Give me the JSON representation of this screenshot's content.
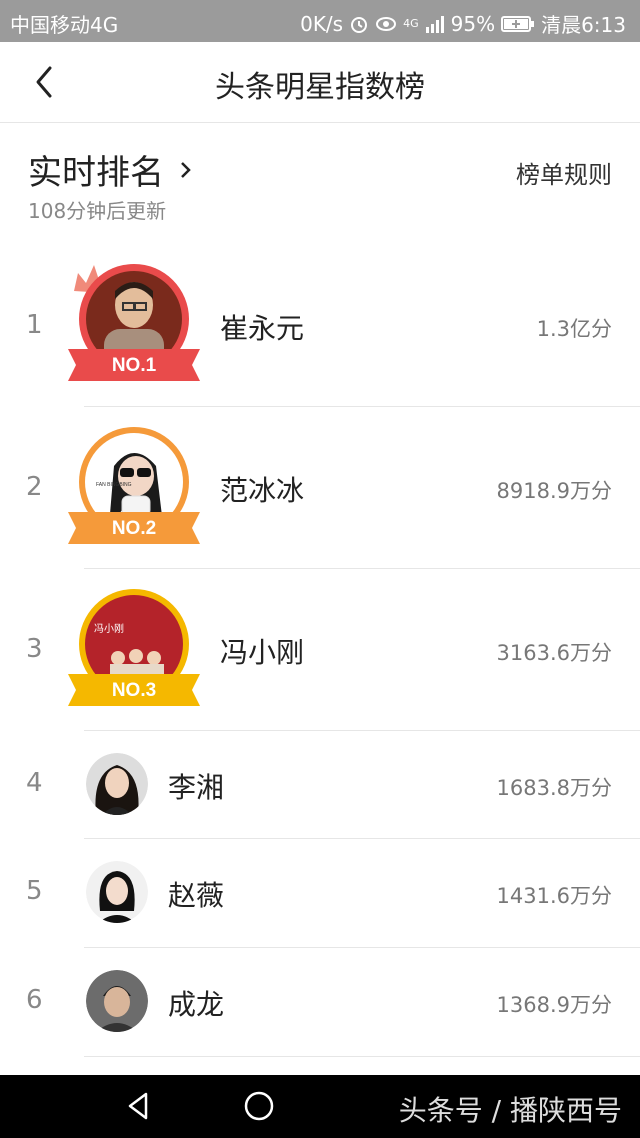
{
  "status": {
    "carrier": "中国移动4G",
    "speed": "0K/s",
    "network": "4G",
    "battery": "95%",
    "time": "清晨6:13"
  },
  "nav": {
    "title": "头条明星指数榜"
  },
  "section": {
    "title": "实时排名",
    "subtitle": "108分钟后更新",
    "rules": "榜单规则"
  },
  "badges": [
    "NO.1",
    "NO.2",
    "NO.3"
  ],
  "list": [
    {
      "rank": "1",
      "name": "崔永元",
      "score": "1.3亿分"
    },
    {
      "rank": "2",
      "name": "范冰冰",
      "score": "8918.9万分"
    },
    {
      "rank": "3",
      "name": "冯小刚",
      "score": "3163.6万分"
    },
    {
      "rank": "4",
      "name": "李湘",
      "score": "1683.8万分"
    },
    {
      "rank": "5",
      "name": "赵薇",
      "score": "1431.6万分"
    },
    {
      "rank": "6",
      "name": "成龙",
      "score": "1368.9万分"
    }
  ],
  "avatar_texts": {
    "fan_text": "FAN BINGBING",
    "film_text": "冯小刚"
  },
  "watermark": "头条号 / 播陕西号",
  "colors": {
    "no1": "#e94b4b",
    "no2": "#f59a3a",
    "no3": "#f5b800"
  }
}
